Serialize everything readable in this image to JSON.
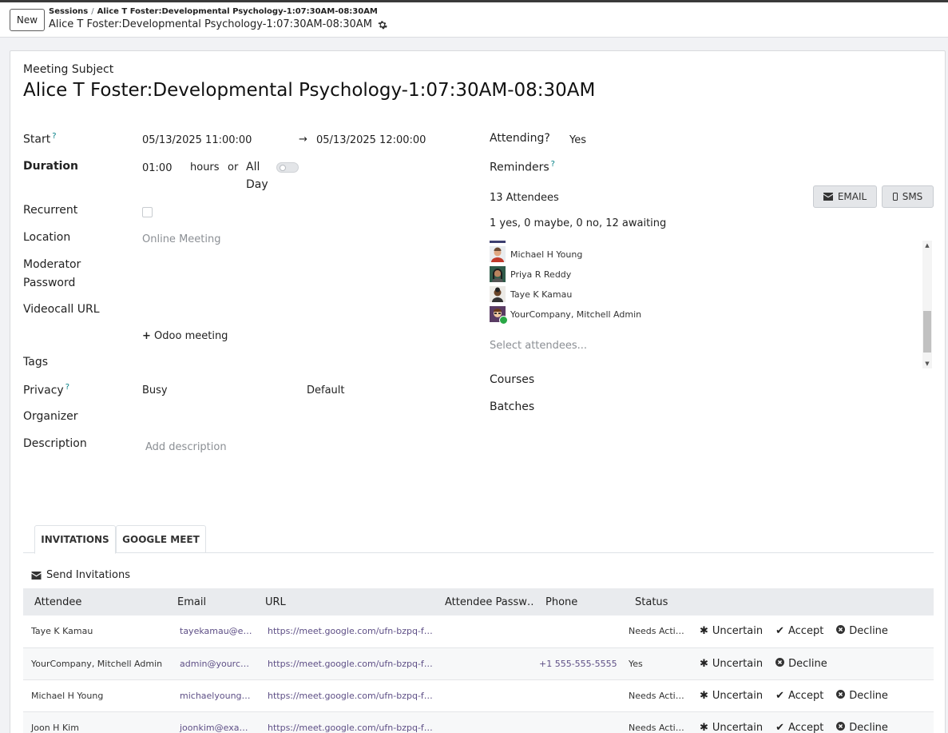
{
  "control_panel": {
    "new_label": "New",
    "breadcrumb_root": "Sessions",
    "breadcrumb_sep": "/",
    "breadcrumb_current": "Alice T Foster:Developmental Psychology-1:07:30AM-08:30AM",
    "record_title": "Alice T Foster:Developmental Psychology-1:07:30AM-08:30AM"
  },
  "form": {
    "subject_label": "Meeting Subject",
    "subject": "Alice T Foster:Developmental Psychology-1:07:30AM-08:30AM",
    "start_label": "Start",
    "start": "05/13/2025 11:00:00",
    "stop": "05/13/2025 12:00:00",
    "arrow": "→",
    "duration_label": "Duration",
    "duration": "01:00",
    "hours": "hours",
    "or": "or",
    "allday_1": "All",
    "allday_2": "Day",
    "recurrent_label": "Recurrent",
    "location_label": "Location",
    "location": "Online Meeting",
    "moderator_label_1": "Moderator",
    "moderator_label_2": "Password",
    "videocall_label": "Videocall URL",
    "odoo_meeting": "Odoo meeting",
    "tags_label": "Tags",
    "privacy_label": "Privacy",
    "show_as": "Busy",
    "privacy": "Default",
    "organizer_label": "Organizer",
    "description_label": "Description",
    "description_placeholder": "Add description",
    "attending_label": "Attending?",
    "attending": "Yes",
    "reminders_label": "Reminders",
    "attendees_count": "13 Attendees",
    "email_btn": "EMAIL",
    "sms_btn": "SMS",
    "attendees_summary": "1 yes, 0 maybe, 0 no, 12 awaiting",
    "attendees": [
      "Michael H Young",
      "Priya R Reddy",
      "Taye K Kamau",
      "YourCompany, Mitchell Admin"
    ],
    "select_attendees": "Select attendees...",
    "courses_label": "Courses",
    "batches_label": "Batches",
    "help_mark": "?"
  },
  "tabs": [
    "INVITATIONS",
    "GOOGLE MEET"
  ],
  "send_invitations": "Send Invitations",
  "table": {
    "headers": [
      "Attendee",
      "Email",
      "URL",
      "Attendee Passw…",
      "Phone",
      "Status"
    ],
    "actions": {
      "uncertain": "Uncertain",
      "accept": "Accept",
      "decline": "Decline"
    },
    "rows": [
      {
        "attendee": "Taye K Kamau",
        "email": "tayekamau@e…",
        "url": "https://meet.google.com/ufn-bzpq-f…",
        "password": "",
        "phone": "",
        "status": "Needs Acti…"
      },
      {
        "attendee": "YourCompany, Mitchell Admin",
        "email": "admin@yourc…",
        "url": "https://meet.google.com/ufn-bzpq-f…",
        "password": "",
        "phone": "+1 555-555-5555",
        "status": "Yes"
      },
      {
        "attendee": "Michael H Young",
        "email": "michaelyoung…",
        "url": "https://meet.google.com/ufn-bzpq-f…",
        "password": "",
        "phone": "",
        "status": "Needs Acti…"
      },
      {
        "attendee": "Joon H Kim",
        "email": "joonkim@exa…",
        "url": "https://meet.google.com/ufn-bzpq-f…",
        "password": "",
        "phone": "",
        "status": "Needs Acti…"
      }
    ]
  },
  "colors": {
    "link": "#5e4f86",
    "help": "#017e84",
    "accept_status": "#28a745"
  }
}
